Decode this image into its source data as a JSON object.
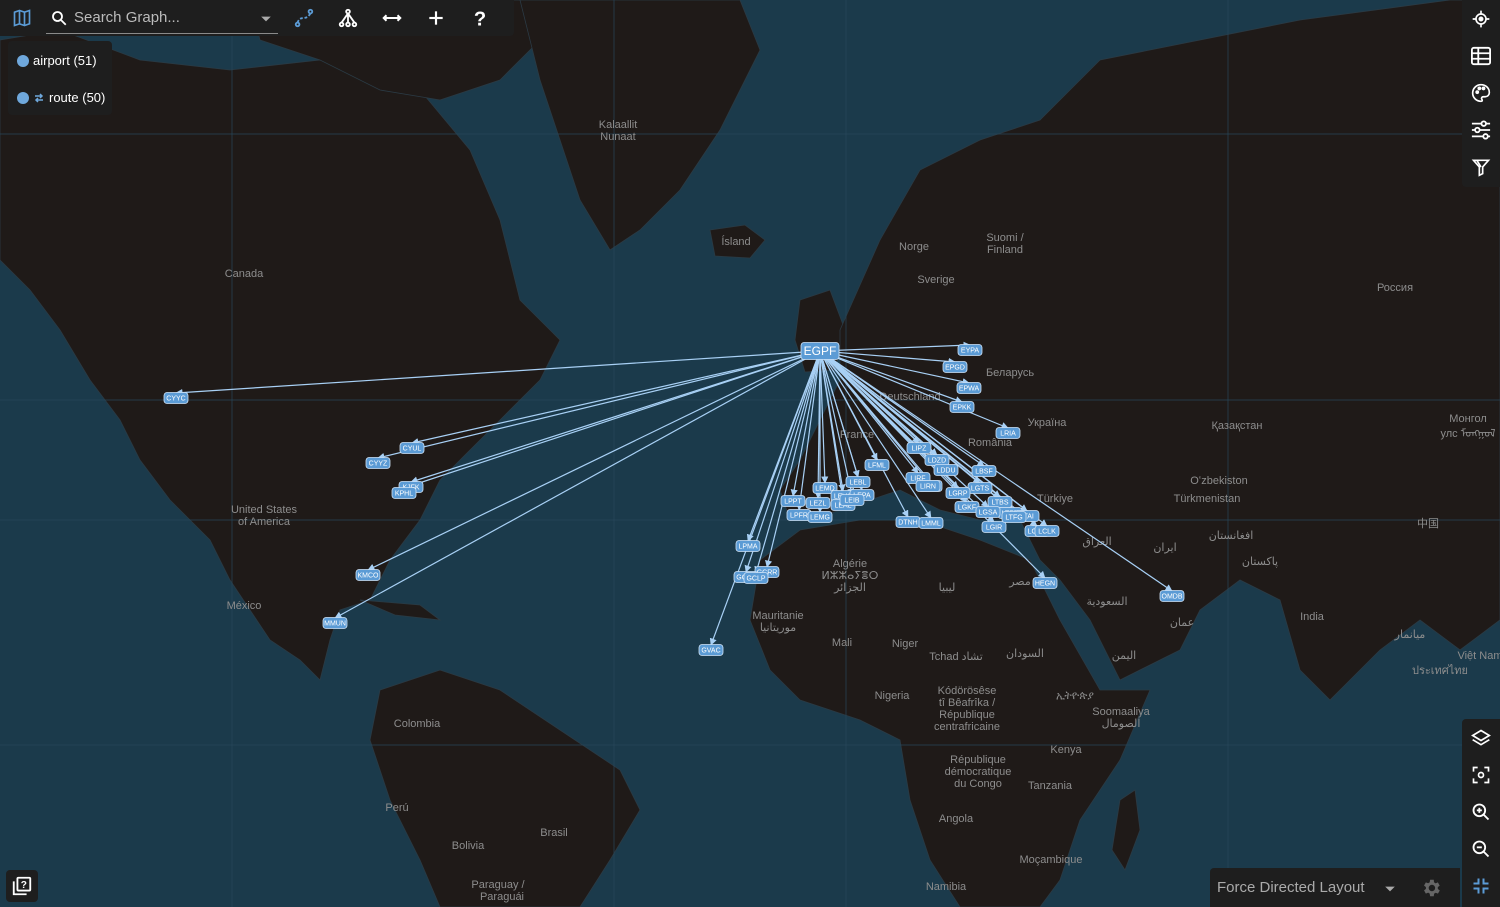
{
  "search": {
    "placeholder": "Search Graph..."
  },
  "legend": {
    "airport_label": "airport (51)",
    "route_label": "route (50)",
    "airport_color": "#6fa8dc",
    "route_color": "#6fa8dc"
  },
  "layout": {
    "selected": "Force Directed Layout"
  },
  "colors": {
    "ocean": "#1b3a4b",
    "land": "#1f1a18",
    "edge": "#a8d0f5",
    "node": "#5b9bd5",
    "panel": "#1e1e1e"
  },
  "toolbar_icons": [
    "map-icon",
    "search-icon",
    "chevron-down-icon",
    "curve-icon",
    "hierarchy-icon",
    "arrows-horizontal-icon",
    "plus-icon",
    "help-icon"
  ],
  "right_icons": [
    "locate-icon",
    "table-icon",
    "palette-icon",
    "sliders-icon",
    "filter-icon"
  ],
  "right_icons_bottom": [
    "layers-icon",
    "fit-view-icon",
    "zoom-in-icon",
    "zoom-out-icon",
    "collapse-icon"
  ],
  "map_labels": [
    {
      "text": "Kalaallit"
    },
    {
      "text": "Nunaat"
    },
    {
      "text": "Ísland"
    },
    {
      "text": "Canada"
    },
    {
      "text": "Norge"
    },
    {
      "text": "Sverige"
    },
    {
      "text": "Suomi /"
    },
    {
      "text": "Finland"
    },
    {
      "text": "Россия"
    },
    {
      "text": "Беларусь"
    },
    {
      "text": "Україна"
    },
    {
      "text": "Deutschland"
    },
    {
      "text": "France"
    },
    {
      "text": "România"
    },
    {
      "text": "Қазақстан"
    },
    {
      "text": "Oʻzbekiston"
    },
    {
      "text": "Türkmenistan"
    },
    {
      "text": "Türkiye"
    },
    {
      "text": "افغانستان"
    },
    {
      "text": "ایران"
    },
    {
      "text": "العراق"
    },
    {
      "text": "پاکستان"
    },
    {
      "text": "中国"
    },
    {
      "text": "Монгол"
    },
    {
      "text": "улс ᠮᠤᠩᠭᠤᠯ"
    },
    {
      "text": "India"
    },
    {
      "text": "ميانمار"
    },
    {
      "text": "Việt Nam"
    },
    {
      "text": "ประเทศไทย"
    },
    {
      "text": "United States"
    },
    {
      "text": "of America"
    },
    {
      "text": "México"
    },
    {
      "text": "Algérie"
    },
    {
      "text": "ⵍⵣⵣⴰⵢⴻⵔ"
    },
    {
      "text": "الجزائر"
    },
    {
      "text": "ليبيا"
    },
    {
      "text": "مصر"
    },
    {
      "text": "السعودية"
    },
    {
      "text": "عمان"
    },
    {
      "text": "اليمن"
    },
    {
      "text": "Mauritanie"
    },
    {
      "text": "موريتانيا"
    },
    {
      "text": "Mali"
    },
    {
      "text": "Niger"
    },
    {
      "text": "Tchad تشاد"
    },
    {
      "text": "السودان"
    },
    {
      "text": "Nigeria"
    },
    {
      "text": "ኢትዮጵያ"
    },
    {
      "text": "Soomaaliya"
    },
    {
      "text": "الصومال"
    },
    {
      "text": "Kenya"
    },
    {
      "text": "Kódörösêse"
    },
    {
      "text": "tî Bêafrîka /"
    },
    {
      "text": "République"
    },
    {
      "text": "centrafricaine"
    },
    {
      "text": "République"
    },
    {
      "text": "démocratique"
    },
    {
      "text": "du Congo"
    },
    {
      "text": "Tanzania"
    },
    {
      "text": "Angola"
    },
    {
      "text": "Moçambique"
    },
    {
      "text": "Namibia"
    },
    {
      "text": "Colombia"
    },
    {
      "text": "Perú"
    },
    {
      "text": "Brasil"
    },
    {
      "text": "Bolivia"
    },
    {
      "text": "Paraguay /"
    },
    {
      "text": "Paraguái"
    }
  ],
  "hub": {
    "code": "EGPF"
  },
  "airports": [
    {
      "code": "EYPA"
    },
    {
      "code": "EPGD"
    },
    {
      "code": "EPWA"
    },
    {
      "code": "EPKK"
    },
    {
      "code": "LRIA"
    },
    {
      "code": "CYYC"
    },
    {
      "code": "CYUL"
    },
    {
      "code": "CYYZ"
    },
    {
      "code": "KJFK"
    },
    {
      "code": "KPHL"
    },
    {
      "code": "KMCO"
    },
    {
      "code": "MMUN"
    },
    {
      "code": "LPMA"
    },
    {
      "code": "GCRR"
    },
    {
      "code": "GCTS"
    },
    {
      "code": "GCLP"
    },
    {
      "code": "GVAC"
    },
    {
      "code": "LPPT"
    },
    {
      "code": "LPFR"
    },
    {
      "code": "LEMD"
    },
    {
      "code": "LEMG"
    },
    {
      "code": "LEVC"
    },
    {
      "code": "LEAL"
    },
    {
      "code": "LEBL"
    },
    {
      "code": "LEPA"
    },
    {
      "code": "LFML"
    },
    {
      "code": "LIPZ"
    },
    {
      "code": "LDZD"
    },
    {
      "code": "LIRF"
    },
    {
      "code": "LQSA"
    },
    {
      "code": "LBSF"
    },
    {
      "code": "LGTS"
    },
    {
      "code": "LGKF"
    },
    {
      "code": "DTNH"
    },
    {
      "code": "LMML"
    },
    {
      "code": "LGIR"
    },
    {
      "code": "LTFE"
    },
    {
      "code": "LTAI"
    },
    {
      "code": "LCPH"
    },
    {
      "code": "LCLK"
    },
    {
      "code": "HEGN"
    },
    {
      "code": "OMDB"
    },
    {
      "code": "LDDU"
    },
    {
      "code": "LGRP"
    },
    {
      "code": "LTBS"
    },
    {
      "code": "LTFG"
    },
    {
      "code": "LEIB"
    },
    {
      "code": "LEZL"
    },
    {
      "code": "LGSA"
    },
    {
      "code": "LIRN"
    }
  ]
}
